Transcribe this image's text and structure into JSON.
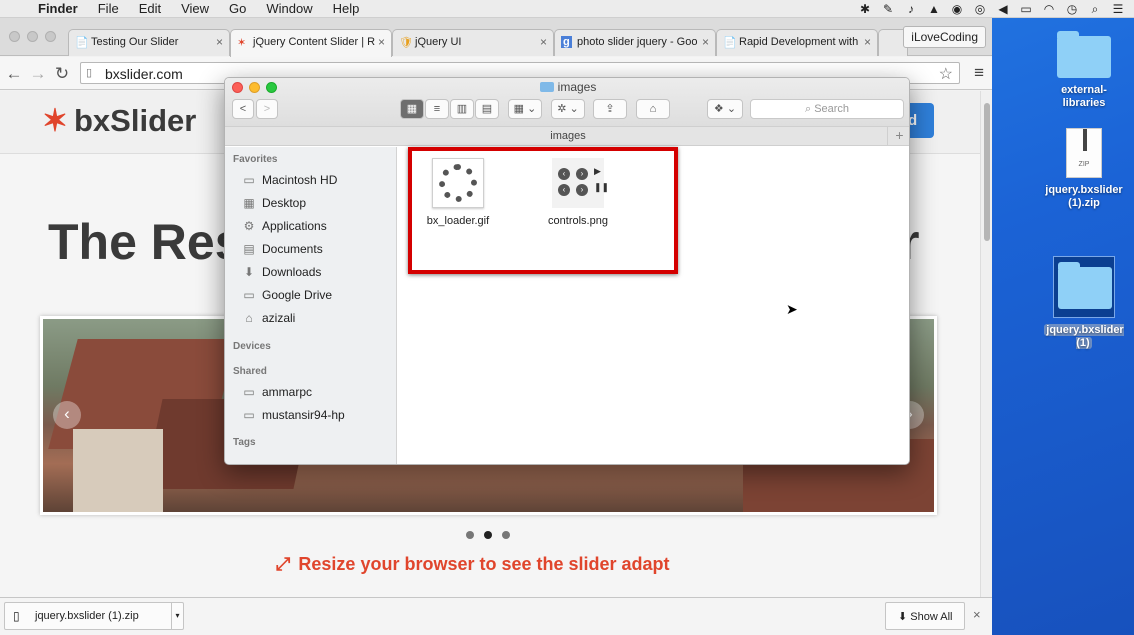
{
  "menubar": {
    "apple": "",
    "app_name": "Finder",
    "items": [
      "File",
      "Edit",
      "View",
      "Go",
      "Window",
      "Help"
    ],
    "status_icons": [
      "bluetooth-icon",
      "tool-icon",
      "bell-icon",
      "drive-icon",
      "app-icon",
      "record-icon",
      "volume-icon",
      "battery-icon",
      "wifi-icon",
      "clock-icon",
      "search-icon",
      "list-icon"
    ]
  },
  "browser": {
    "tabs": [
      {
        "label": "Testing Our Slider",
        "favicon": "📄"
      },
      {
        "label": "jQuery Content Slider | R",
        "favicon": "✶"
      },
      {
        "label": "jQuery UI",
        "favicon": "🛡"
      },
      {
        "label": "photo slider jquery - Goo",
        "favicon": "g"
      },
      {
        "label": "Rapid Development with",
        "favicon": "📄"
      }
    ],
    "tab_close": "×",
    "profile_label": "iLoveCoding",
    "url": "bxslider.com",
    "downloads": {
      "file_name": "jquery.bxslider (1).zip",
      "show_all": "Show All",
      "close": "×"
    }
  },
  "webpage": {
    "logo": "bxSlider",
    "logo_mark": "✶",
    "download_btn_tail": "d",
    "hero_title_visible": "The Res",
    "hero_right_visible": "r",
    "arrow_left": "‹",
    "arrow_right": "›",
    "resize_note": "Resize your browser to see the slider adapt",
    "resize_icon": "⤢"
  },
  "finder": {
    "title": "images",
    "path_title": "images",
    "search_placeholder": "Search",
    "toolbar": {
      "back": "<",
      "forward": ">",
      "view_icon": "▦",
      "view_list": "≡",
      "view_columns": "▥",
      "view_cover": "▤",
      "arrange": "▦ ⌄",
      "action": "✲ ⌄",
      "share": "⇪",
      "tag": "⌂",
      "dropbox": "❖ ⌄",
      "search_icon": "⌕"
    },
    "plus": "+",
    "sidebar": {
      "favorites_label": "Favorites",
      "favorites": [
        {
          "label": "Macintosh HD",
          "icon": "▭"
        },
        {
          "label": "Desktop",
          "icon": "▦"
        },
        {
          "label": "Applications",
          "icon": "⚙"
        },
        {
          "label": "Documents",
          "icon": "▤"
        },
        {
          "label": "Downloads",
          "icon": "⬇"
        },
        {
          "label": "Google Drive",
          "icon": "▭"
        },
        {
          "label": "azizali",
          "icon": "⌂"
        }
      ],
      "devices_label": "Devices",
      "shared_label": "Shared",
      "shared": [
        {
          "label": "ammarpc",
          "icon": "▭"
        },
        {
          "label": "mustansir94-hp",
          "icon": "▭"
        }
      ],
      "tags_label": "Tags"
    },
    "files": [
      {
        "name": "bx_loader.gif"
      },
      {
        "name": "controls.png"
      }
    ]
  },
  "desktop": {
    "icons": [
      {
        "label": "external-libraries",
        "kind": "folder"
      },
      {
        "label": "jquery.bxslider (1).zip",
        "kind": "zip",
        "zip_tag": "ZIP"
      },
      {
        "label": "jquery.bxslider (1)",
        "kind": "folder",
        "selected": true
      }
    ]
  },
  "colors": {
    "highlight_border": "#d40000",
    "brand_red": "#e0452c",
    "desktop_blue": "#1b63d6"
  }
}
